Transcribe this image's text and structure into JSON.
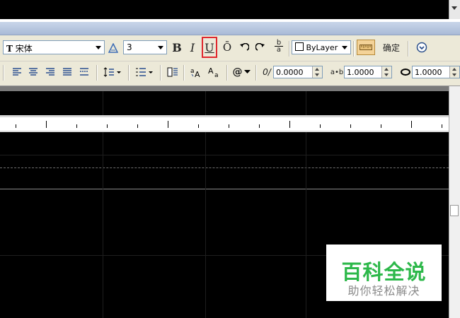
{
  "toolbar": {
    "font_combo": {
      "icon_glyph": "T",
      "value": "宋体"
    },
    "size_combo": {
      "value": "3"
    },
    "bold_label": "B",
    "italic_label": "I",
    "underline_label": "U",
    "overline_label": "Ō",
    "stack_label": {
      "top": "b",
      "bottom": "a"
    },
    "color_combo": {
      "value": "ByLayer"
    },
    "confirm_label": "确定",
    "oblique_value": "0.0000",
    "tracking_value": "1.0000",
    "width_factor_value": "1.0000",
    "oblique_glyph": "0/",
    "tracking_glyph": "a•b",
    "symbol_glyph": "@"
  },
  "colors": {
    "highlight_border": "#e0282e",
    "watermark_green": "#2db84a",
    "watermark_grey": "#8a8a8a",
    "title_band": "#b8c7e0"
  },
  "watermark": {
    "title": "百科全说",
    "subtitle": "助你轻松解决"
  }
}
